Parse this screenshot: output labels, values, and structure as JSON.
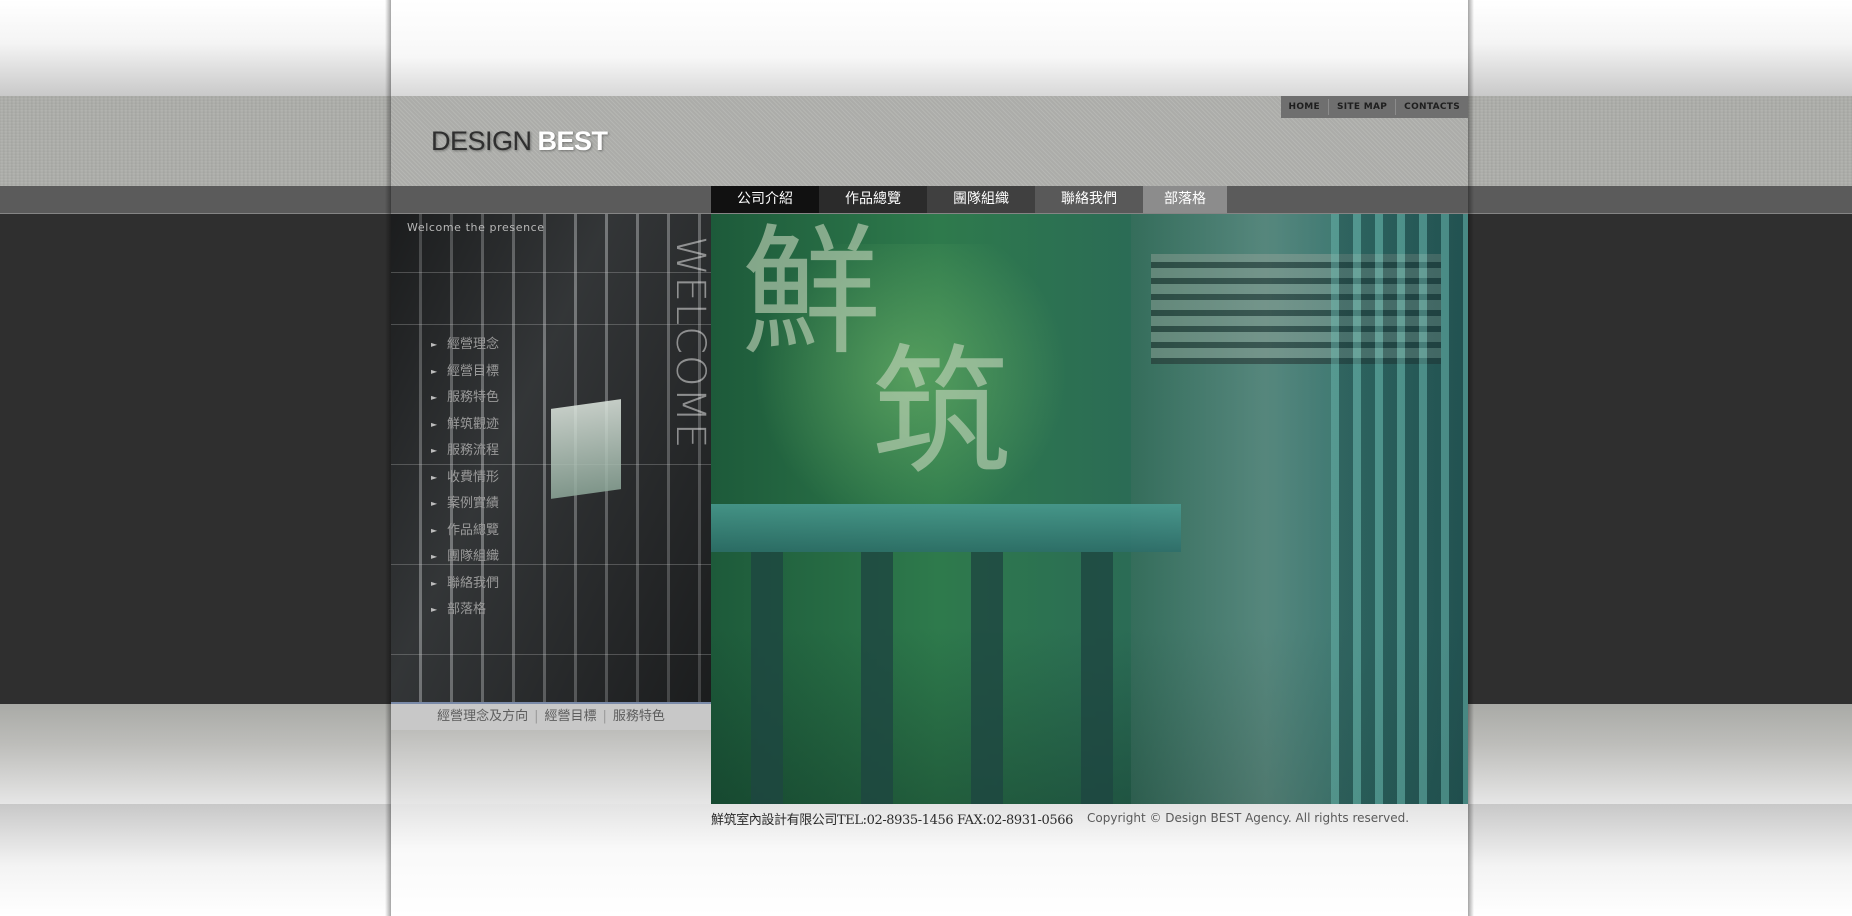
{
  "logo": {
    "word1": "DESIGN",
    "word2": "BEST"
  },
  "utility_nav": [
    {
      "label": "HOME"
    },
    {
      "label": "SITE MAP"
    },
    {
      "label": "CONTACTS"
    }
  ],
  "main_nav": [
    {
      "label": "公司介紹"
    },
    {
      "label": "作品總覽"
    },
    {
      "label": "團隊組織"
    },
    {
      "label": "聯絡我們"
    },
    {
      "label": "部落格"
    }
  ],
  "sidebar": {
    "tagline": "Welcome the presence",
    "welcome_word": "WELCOME",
    "menu": [
      {
        "label": "經營理念"
      },
      {
        "label": "經營目標"
      },
      {
        "label": "服務特色"
      },
      {
        "label": "鮮筑觀迹"
      },
      {
        "label": "服務流程"
      },
      {
        "label": "收費情形"
      },
      {
        "label": "案例實績"
      },
      {
        "label": "作品總覽"
      },
      {
        "label": "團隊組織"
      },
      {
        "label": "聯絡我們"
      },
      {
        "label": "部落格"
      }
    ],
    "sub_links": [
      {
        "label": "經營理念及方向"
      },
      {
        "label": "經營目標"
      },
      {
        "label": "服務特色"
      }
    ]
  },
  "hero": {
    "calligraphy_1": "鮮",
    "calligraphy_2": "筑"
  },
  "footer": {
    "company": "鮮筑室內設計有限公司TEL:02-8935-1456 FAX:02-8931-0566",
    "copyright": "Copyright © Design BEST Agency. All rights reserved."
  }
}
